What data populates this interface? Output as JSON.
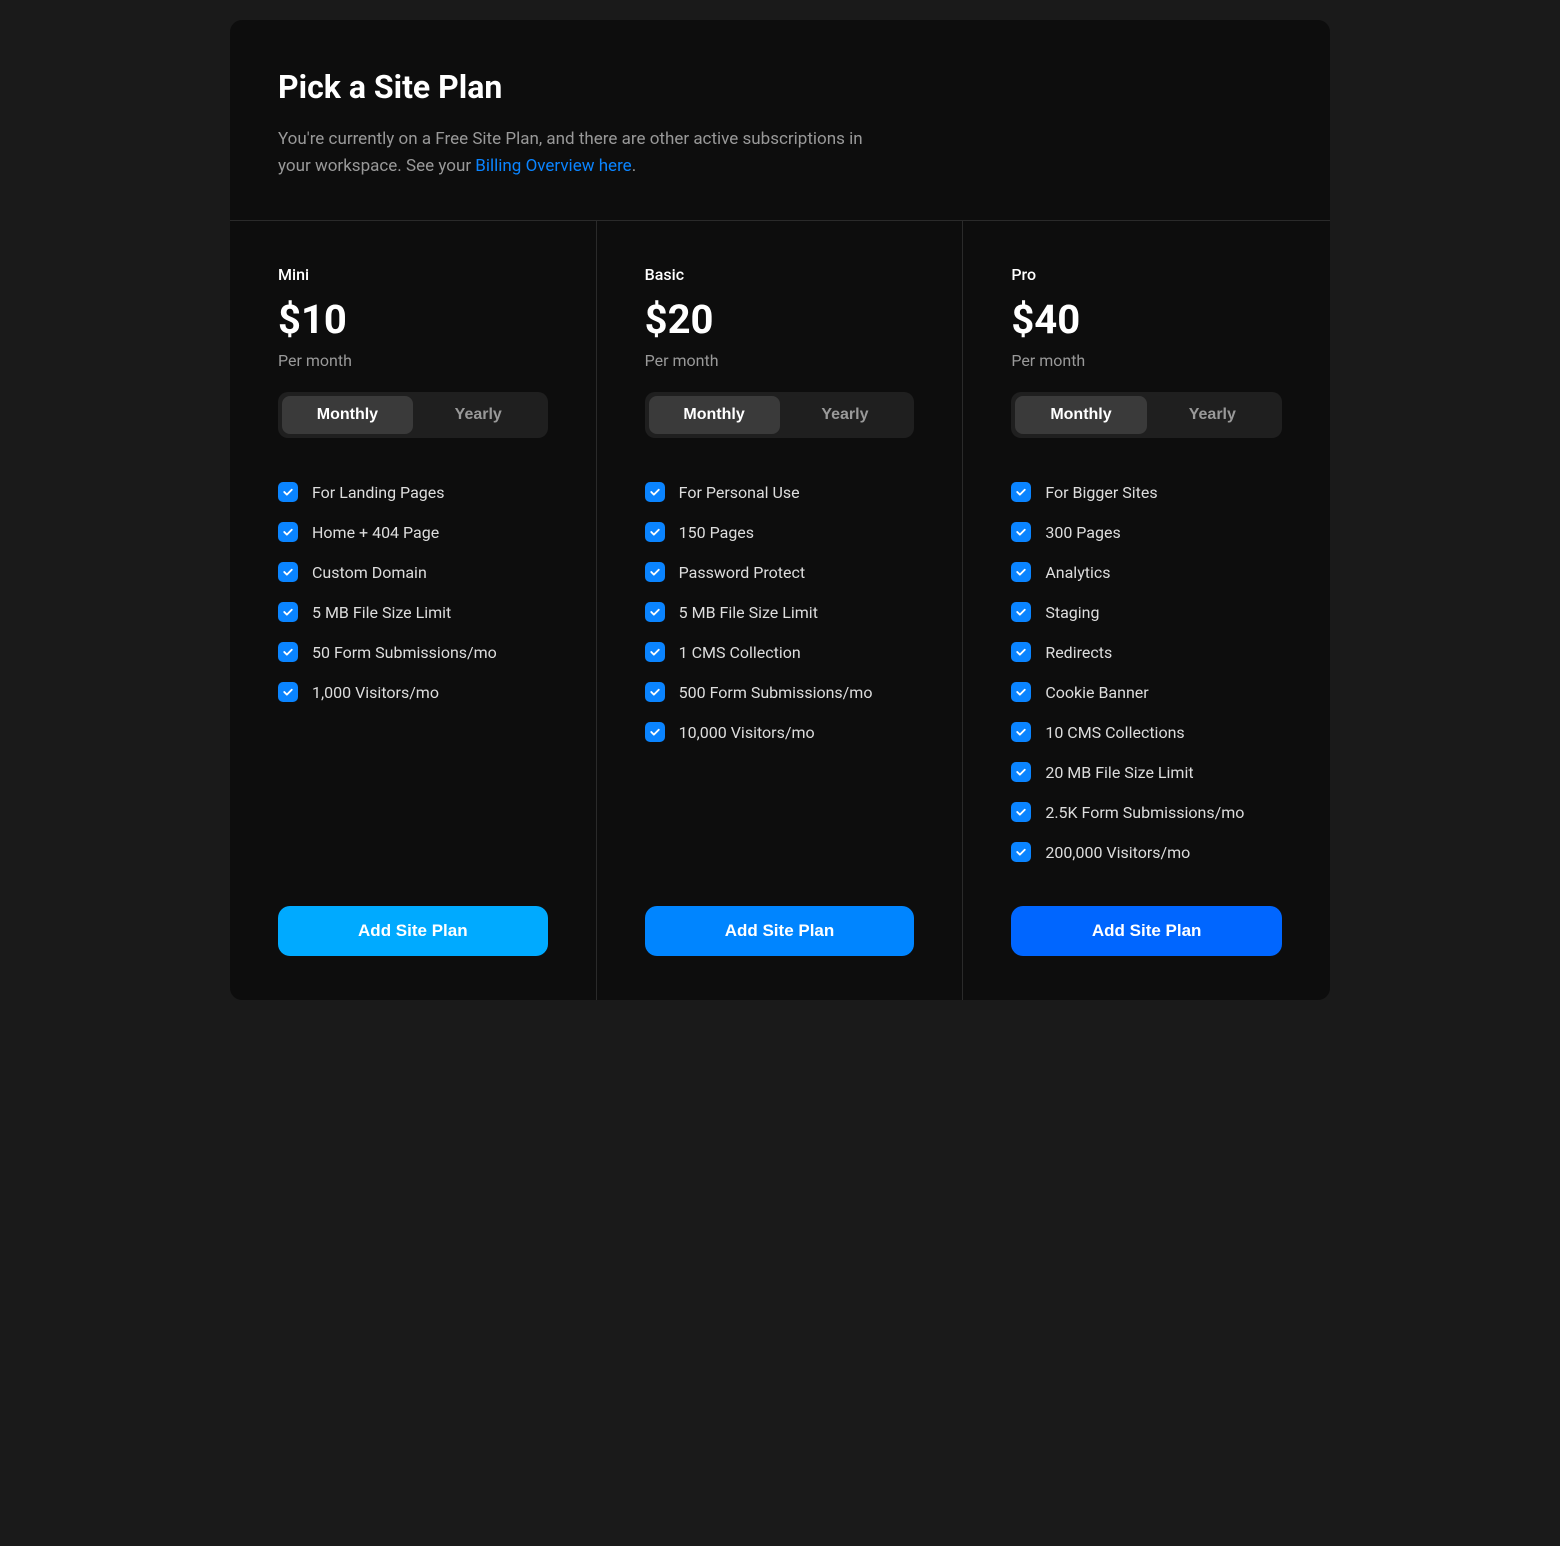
{
  "header": {
    "title": "Pick a Site Plan",
    "subtitle_before_link": "You're currently on a Free Site Plan, and there are other active subscriptions in your workspace. See your ",
    "link_text": "Billing Overview here",
    "subtitle_after_link": "."
  },
  "toggle": {
    "monthly": "Monthly",
    "yearly": "Yearly"
  },
  "plans": [
    {
      "name": "Mini",
      "price": "$10",
      "period": "Per month",
      "cta": "Add Site Plan",
      "features": [
        "For Landing Pages",
        "Home + 404 Page",
        "Custom Domain",
        "5 MB File Size Limit",
        "50 Form Submissions/mo",
        "1,000 Visitors/mo"
      ]
    },
    {
      "name": "Basic",
      "price": "$20",
      "period": "Per month",
      "cta": "Add Site Plan",
      "features": [
        "For Personal Use",
        "150 Pages",
        "Password Protect",
        "5 MB File Size Limit",
        "1 CMS Collection",
        "500 Form Submissions/mo",
        "10,000 Visitors/mo"
      ]
    },
    {
      "name": "Pro",
      "price": "$40",
      "period": "Per month",
      "cta": "Add Site Plan",
      "features": [
        "For Bigger Sites",
        "300 Pages",
        "Analytics",
        "Staging",
        "Redirects",
        "Cookie Banner",
        "10 CMS Collections",
        "20 MB File Size Limit",
        "2.5K Form Submissions/mo",
        "200,000 Visitors/mo"
      ]
    }
  ]
}
